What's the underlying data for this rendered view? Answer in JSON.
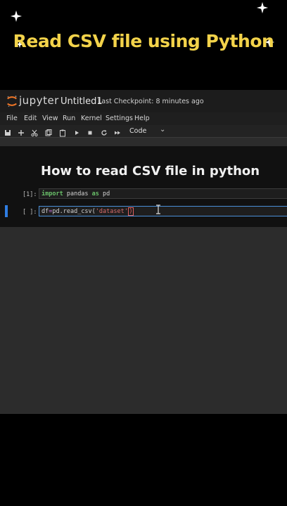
{
  "banner": {
    "title": "Read CSV file using Python"
  },
  "app": {
    "logo_text": "jupyter",
    "notebook_title": "Untitled1",
    "checkpoint": "Last Checkpoint: 8 minutes ago"
  },
  "menu": [
    "File",
    "Edit",
    "View",
    "Run",
    "Kernel",
    "Settings",
    "Help"
  ],
  "toolbar": {
    "icons": [
      "save-icon",
      "plus-icon",
      "cut-icon",
      "copy-icon",
      "paste-icon",
      "run-icon",
      "stop-icon",
      "restart-icon",
      "fast-forward-icon"
    ],
    "cell_type": "Code",
    "cell_type_chevron": "⌄"
  },
  "notebook": {
    "heading": "How to read CSV file in python",
    "cells": [
      {
        "prompt": "[1]:",
        "tokens": {
          "kw1": "import",
          "mod": " pandas ",
          "kw2": "as",
          "alias": " pd"
        }
      },
      {
        "prompt": "[ ]:",
        "tokens": {
          "var": "df",
          "eq": "=",
          "call": "pd.read_csv(",
          "str": "'dataset'",
          "paren": ")"
        }
      }
    ]
  },
  "colors": {
    "banner_text": "#f3d34a",
    "keyword": "#6ac16a",
    "string": "#d86c6c",
    "active_cell": "#2f7de1",
    "logo_orange": "#f37726"
  }
}
